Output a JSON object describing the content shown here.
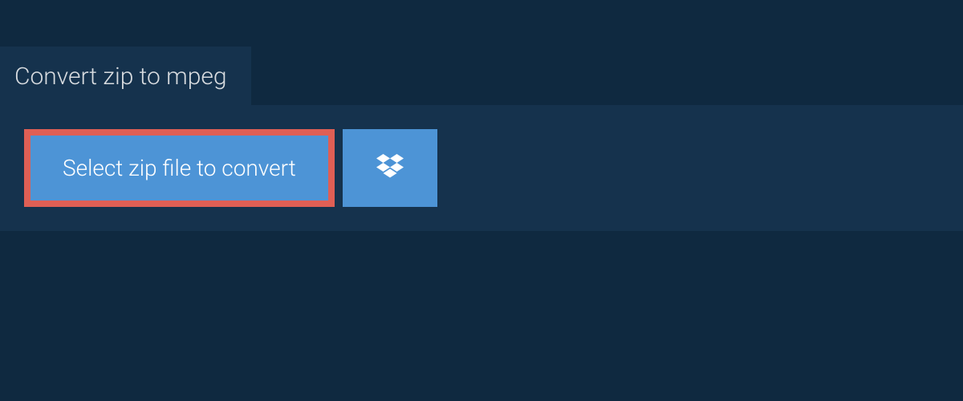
{
  "header": {
    "title": "Convert zip to mpeg"
  },
  "actions": {
    "select_file_label": "Select zip file to convert",
    "dropbox_icon": "dropbox-icon"
  },
  "colors": {
    "background": "#0f2940",
    "panel": "#15324d",
    "button": "#4d94d6",
    "highlight_border": "#df5f55",
    "text_light": "#d8dce0",
    "text_white": "#ffffff"
  }
}
